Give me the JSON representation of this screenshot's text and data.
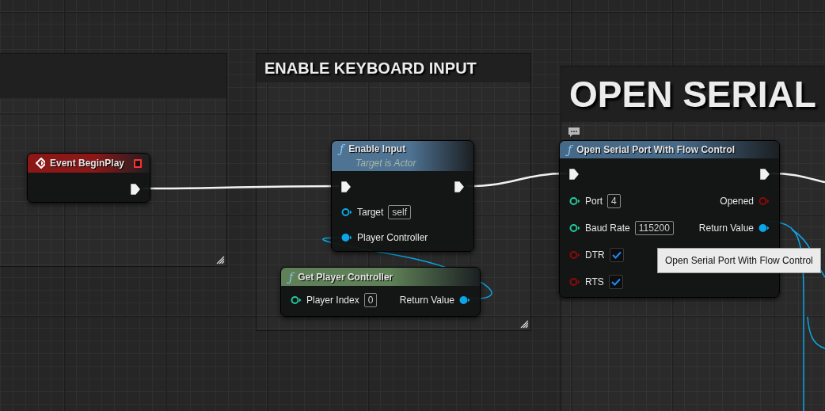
{
  "comments": [
    {
      "title": "ENABLE KEYBOARD INPUT"
    },
    {
      "title": "OPEN SERIAL"
    }
  ],
  "nodes": [
    {
      "kind": "event",
      "title": "Event BeginPlay",
      "color": "#8c1717",
      "outputs": [
        {
          "kind": "exec",
          "connected": true
        }
      ]
    },
    {
      "kind": "function",
      "glyph": "ƒ",
      "title": "Enable Input",
      "subtitle": "Target is Actor",
      "color": "#4f7393",
      "inputs": [
        {
          "kind": "exec",
          "connected": true
        },
        {
          "kind": "object",
          "label": "Target",
          "value": "self",
          "connected": false
        },
        {
          "kind": "object",
          "label": "Player Controller",
          "connected": true
        }
      ],
      "outputs": [
        {
          "kind": "exec",
          "connected": true
        }
      ]
    },
    {
      "kind": "function",
      "glyph": "ƒ",
      "title": "Get Player Controller",
      "color": "#5f8157",
      "inputs": [
        {
          "kind": "int",
          "label": "Player Index",
          "value": "0",
          "connected": false
        }
      ],
      "outputs": [
        {
          "kind": "object",
          "label": "Return Value",
          "connected": true
        }
      ]
    },
    {
      "kind": "function",
      "glyph": "ƒ",
      "title": "Open Serial Port With Flow Control",
      "color": "#466987",
      "inputs": [
        {
          "kind": "exec",
          "connected": true
        },
        {
          "kind": "int",
          "label": "Port",
          "value": "4",
          "connected": false
        },
        {
          "kind": "int",
          "label": "Baud Rate",
          "value": "115200",
          "connected": false
        },
        {
          "kind": "bool",
          "label": "DTR",
          "checked": true,
          "connected": false
        },
        {
          "kind": "bool",
          "label": "RTS",
          "checked": true,
          "connected": false
        }
      ],
      "outputs": [
        {
          "kind": "exec",
          "connected": true
        },
        {
          "kind": "bool",
          "label": "Opened",
          "connected": false
        },
        {
          "kind": "object",
          "label": "Return Value",
          "connected": true
        }
      ]
    }
  ],
  "tooltip": {
    "text": "Open Serial Port With Flow Control"
  }
}
